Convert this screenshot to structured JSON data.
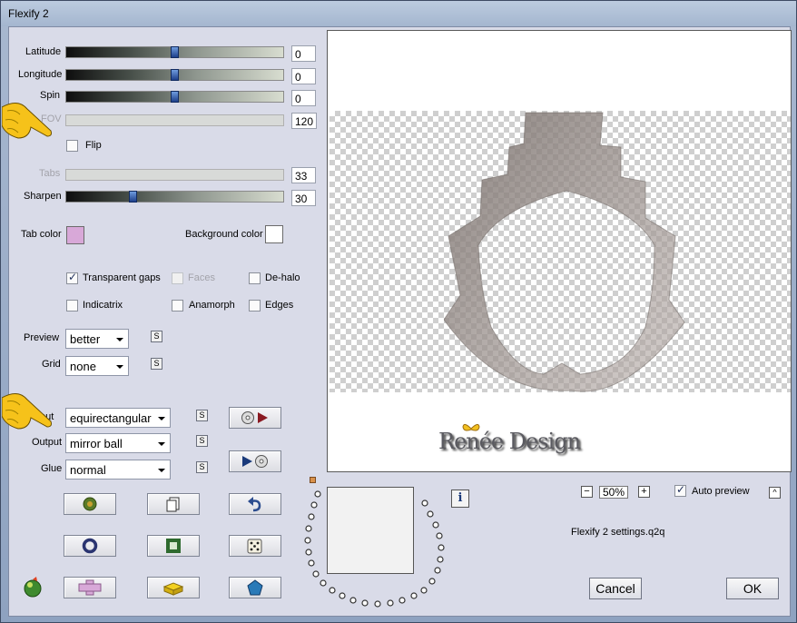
{
  "window": {
    "title": "Flexify 2"
  },
  "sliders": [
    {
      "label": "Latitude",
      "value": "0",
      "level": 0.5,
      "enabled": true
    },
    {
      "label": "Longitude",
      "value": "0",
      "level": 0.5,
      "enabled": true
    },
    {
      "label": "Spin",
      "value": "0",
      "level": 0.5,
      "enabled": true
    },
    {
      "label": "FOV",
      "value": "120",
      "enabled": false
    },
    {
      "label": "Tabs",
      "value": "33",
      "enabled": false
    },
    {
      "label": "Sharpen",
      "value": "30",
      "level": 0.3,
      "enabled": true
    }
  ],
  "flip": {
    "label": "Flip",
    "checked": false
  },
  "colors": {
    "tab_color_label": "Tab color",
    "tab_color": "#d8a8d8",
    "background_color_label": "Background color",
    "background_color": "#ffffff"
  },
  "options": {
    "transparent_gaps": {
      "label": "Transparent gaps",
      "checked": true
    },
    "faces": {
      "label": "Faces",
      "checked": false,
      "enabled": false
    },
    "de_halo": {
      "label": "De-halo",
      "checked": false
    },
    "indicatrix": {
      "label": "Indicatrix",
      "checked": false
    },
    "anamorph": {
      "label": "Anamorph",
      "checked": false
    },
    "edges": {
      "label": "Edges",
      "checked": false
    }
  },
  "preview_select": {
    "label": "Preview",
    "value": "better"
  },
  "grid_select": {
    "label": "Grid",
    "value": "none"
  },
  "input_select": {
    "label": "out",
    "value": "equirectangular"
  },
  "output_select": {
    "label": "Output",
    "value": "mirror ball"
  },
  "glue_select": {
    "label": "Glue",
    "value": "normal"
  },
  "s_button": "S",
  "preview_area": {
    "logo_text": "Renée Design"
  },
  "zoom": {
    "minus": "−",
    "value": "50%",
    "plus": "+"
  },
  "auto_preview": {
    "label": "Auto preview",
    "checked": true
  },
  "settings_file": "Flexify 2 settings.q2q",
  "buttons": {
    "cancel": "Cancel",
    "ok": "OK"
  },
  "info_button": "i",
  "collapse_button": "^"
}
